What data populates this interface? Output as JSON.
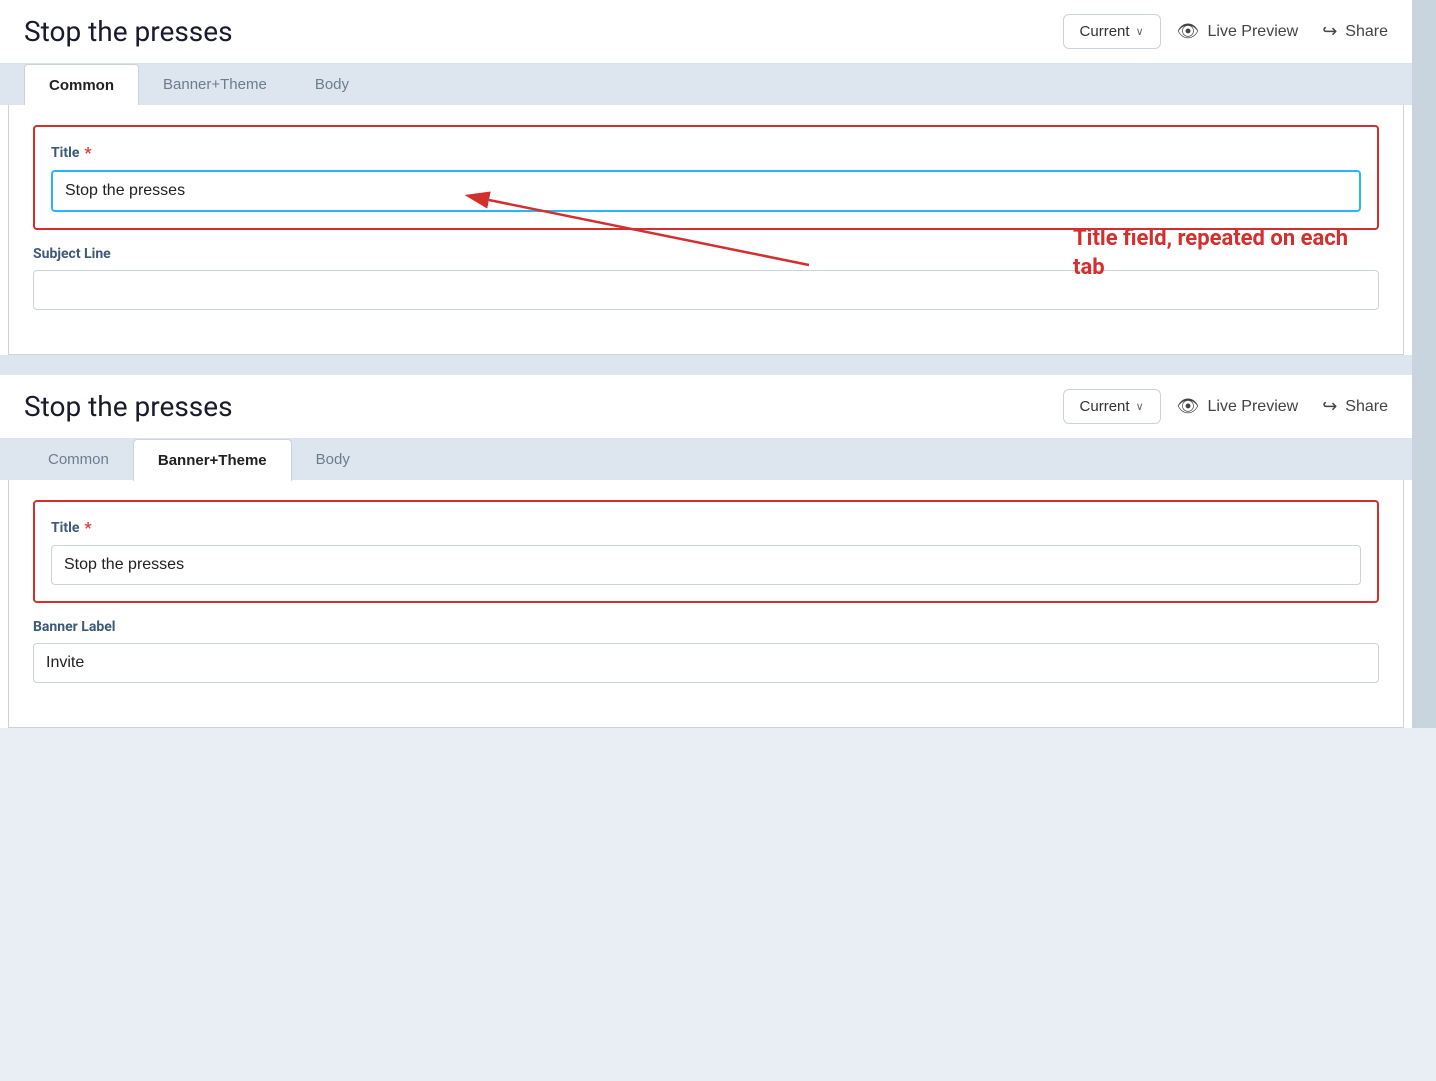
{
  "app": {
    "title": "Stop the presses"
  },
  "header": {
    "title": "Stop the presses",
    "current_label": "Current",
    "live_preview_label": "Live Preview",
    "share_label": "Share"
  },
  "tabs": {
    "common_label": "Common",
    "banner_theme_label": "Banner+Theme",
    "body_label": "Body"
  },
  "panel_top": {
    "active_tab": "Common",
    "title_label": "Title",
    "title_required": "*",
    "title_value": "Stop the presses",
    "subject_line_label": "Subject Line",
    "subject_line_value": ""
  },
  "panel_bottom": {
    "active_tab": "Banner+Theme",
    "title_label": "Title",
    "title_required": "*",
    "title_value": "Stop the presses",
    "banner_label_label": "Banner Label",
    "banner_label_value": "Invite"
  },
  "annotation": {
    "text": "Title field, repeated on each tab"
  },
  "icons": {
    "eye": "👁",
    "share": "↪",
    "chevron": "∨"
  }
}
